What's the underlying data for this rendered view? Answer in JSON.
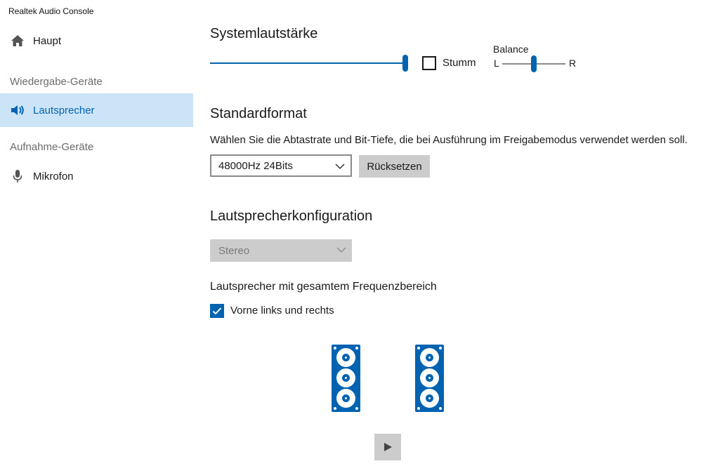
{
  "app": {
    "title": "Realtek Audio Console"
  },
  "sidebar": {
    "items": [
      {
        "label": "Haupt",
        "icon": "home-icon"
      },
      {
        "label": "Lautsprecher",
        "icon": "speaker-icon",
        "active": true
      },
      {
        "label": "Mikrofon",
        "icon": "microphone-icon"
      }
    ],
    "headers": {
      "playback": "Wiedergabe-Geräte",
      "recording": "Aufnahme-Geräte"
    }
  },
  "volume": {
    "title": "Systemlautstärke",
    "level": 1.0,
    "mute_label": "Stumm",
    "mute_checked": false,
    "balance_label": "Balance",
    "balance_left": "L",
    "balance_right": "R",
    "balance_value": 0.5
  },
  "format": {
    "title": "Standardformat",
    "description": "Wählen Sie die Abtastrate und Bit-Tiefe, die bei Ausführung im Freigabemodus verwendet werden soll.",
    "selected": "48000Hz 24Bits",
    "reset_label": "Rücksetzen"
  },
  "config": {
    "title": "Lautsprecherkonfiguration",
    "selected": "Stereo",
    "fullrange_label": "Lautsprecher mit gesamtem Frequenzbereich",
    "front_lr_label": "Vorne links und rechts",
    "front_lr_checked": true
  },
  "colors": {
    "accent": "#0063b1",
    "active_bg": "#cce4f7",
    "control_gray": "#cccccc"
  }
}
